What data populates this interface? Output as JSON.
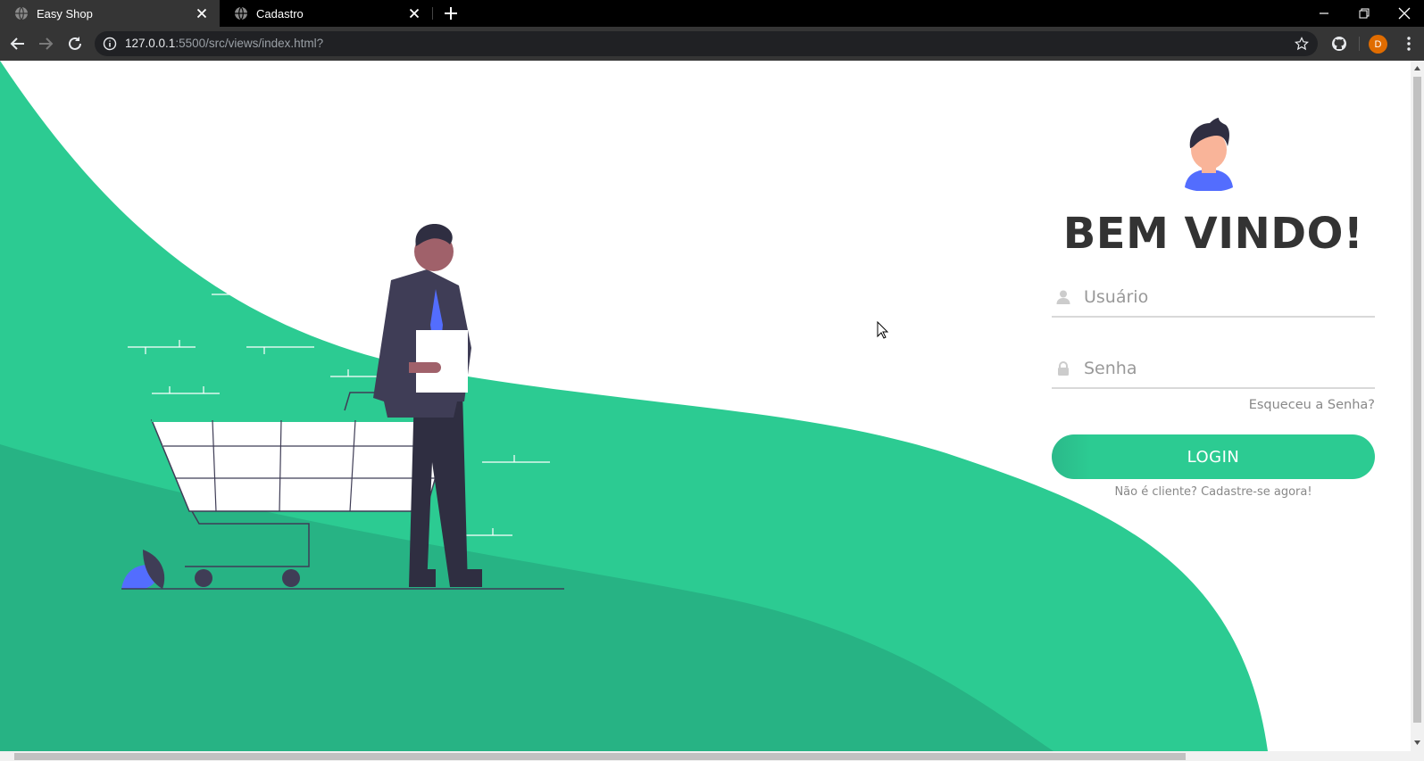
{
  "browser": {
    "tabs": [
      {
        "title": "Easy Shop",
        "active": true
      },
      {
        "title": "Cadastro",
        "active": false
      }
    ],
    "url_host": "127.0.0.1",
    "url_rest": ":5500/src/views/index.html?",
    "profile_initial": "D",
    "icons": {
      "tab_favicon": "globe-icon",
      "tab_close": "close-icon",
      "new_tab": "plus-icon",
      "back": "back-arrow-icon",
      "forward": "forward-arrow-icon",
      "reload": "reload-icon",
      "site_info": "info-icon",
      "bookmark": "star-icon",
      "extension": "github-icon",
      "menu": "kebab-menu-icon",
      "minimize": "minimize-icon",
      "restore": "restore-icon",
      "close_window": "close-icon"
    }
  },
  "login": {
    "welcome": "BEM VINDO!",
    "username_placeholder": "Usuário",
    "password_placeholder": "Senha",
    "forgot_label": "Esqueceu a Senha?",
    "login_label": "LOGIN",
    "signup_label": "Não é cliente? Cadastre-se agora!",
    "icons": {
      "avatar": "user-avatar-icon",
      "user": "user-icon",
      "lock": "lock-icon"
    }
  },
  "theme": {
    "accent": "#2ccb92",
    "accent_dark": "#27b384",
    "text": "#333333",
    "purple": "#3f3d56",
    "blue": "#536dfe"
  }
}
